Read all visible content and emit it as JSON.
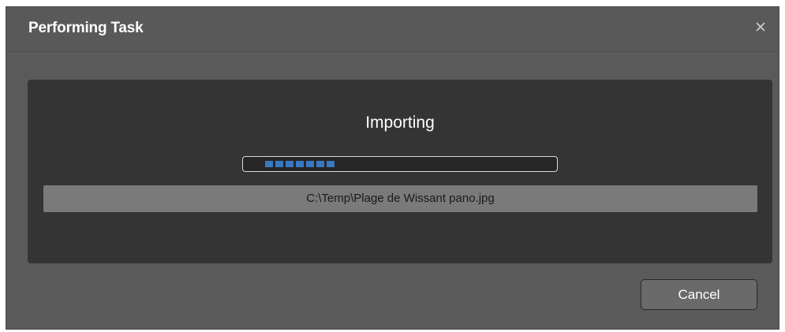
{
  "dialog": {
    "title": "Performing Task",
    "close_icon": "close-icon"
  },
  "task": {
    "status": "Importing",
    "progress_percent": 33,
    "file_path": "C:\\Temp\\Plage de Wissant pano.jpg"
  },
  "actions": {
    "cancel_label": "Cancel"
  },
  "colors": {
    "dialog_bg": "#5a5a5a",
    "panel_bg": "#343434",
    "progress_fill": "#3a78c2",
    "file_bar_bg": "#7a7a7a"
  }
}
